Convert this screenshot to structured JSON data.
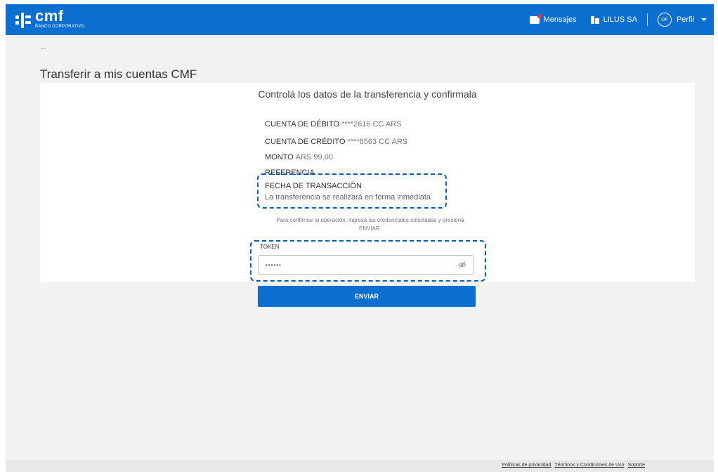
{
  "header": {
    "logo_name": "cmf",
    "logo_sub": "BANCO CORPORATIVO",
    "messages_label": "Mensajes",
    "company_label": "LILUS SA",
    "avatar_initials": "DF",
    "profile_label": "Perfil"
  },
  "back_arrow": "←",
  "page_title": "Transferir a mis cuentas CMF",
  "card": {
    "title": "Controlá los datos de la transferencia y confirmala",
    "debit_label": "CUENTA DE DÉBITO",
    "debit_value": "****2616 CC ARS",
    "credit_label": "CUENTA DE CRÉDITO",
    "credit_value": "****6563 CC ARS",
    "amount_label": "MONTO",
    "amount_value": "ARS 99,00",
    "reference_label": "REFERENCIA",
    "date_label": "FECHA DE TRANSACCIÓN",
    "date_value": "La transferencia se realizará en forma inmediata",
    "instructions": "Para confirmar la operación, ingresá las credenciales solicitadas y presioná ENVIAR.",
    "token_label": "TOKEN",
    "token_value": "••••••"
  },
  "submit_label": "ENVIAR",
  "footer": {
    "privacy": "Políticas de privacidad",
    "terms": "Términos y Condiciones de Uso",
    "support": "Soporte"
  },
  "colors": {
    "brand_blue": "#0a6fd1",
    "annotation_blue": "#0a5bb5",
    "notification_red": "#e5363a"
  }
}
